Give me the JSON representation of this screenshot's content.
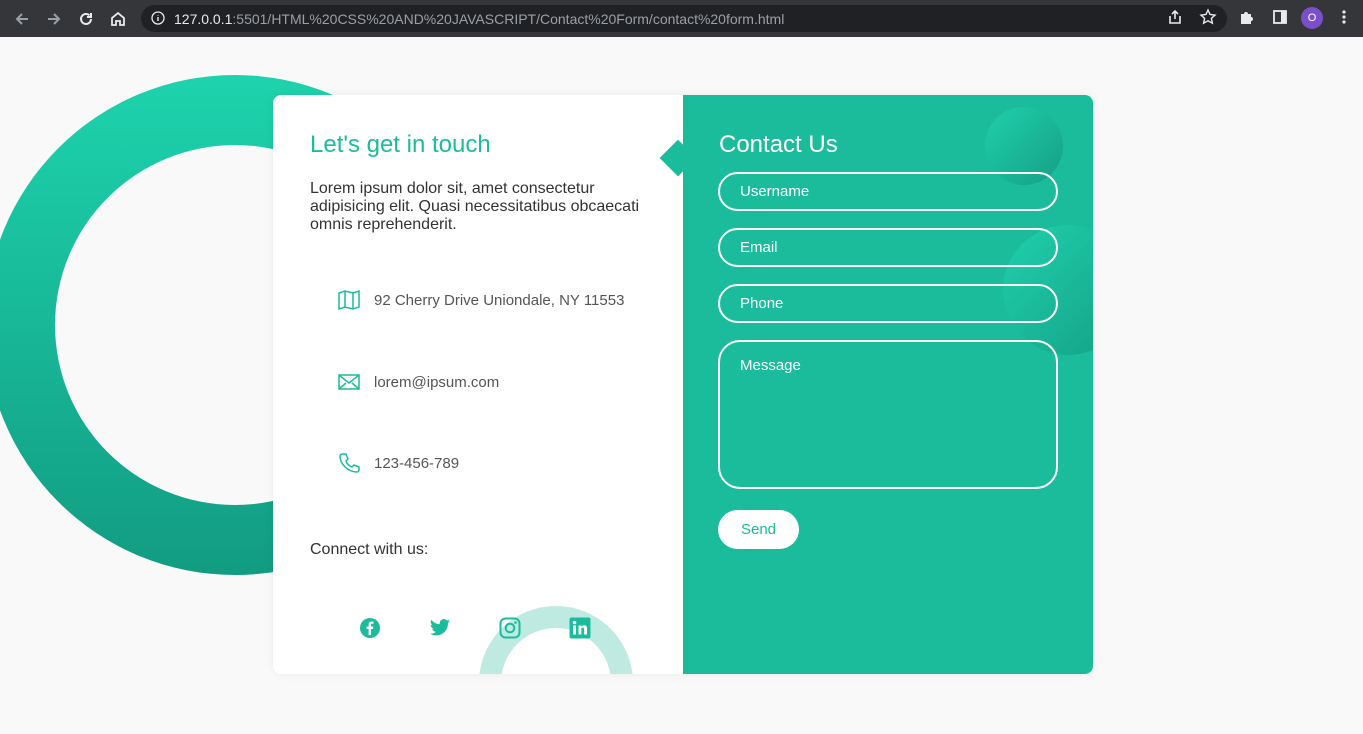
{
  "browser": {
    "url_host": "127.0.0.1",
    "url_rest": ":5501/HTML%20CSS%20AND%20JAVASCRIPT/Contact%20Form/contact%20form.html",
    "profile_initial": "O"
  },
  "contact_info": {
    "title": "Let's get in touch",
    "intro": "Lorem ipsum dolor sit, amet consectetur adipisicing elit. Quasi necessitatibus obcaecati omnis reprehenderit.",
    "address": "92 Cherry Drive Uniondale, NY 11553",
    "email": "lorem@ipsum.com",
    "phone": "123-456-789",
    "connect_label": "Connect with us:",
    "socials": [
      "facebook-icon",
      "twitter-icon",
      "instagram-icon",
      "linkedin-icon"
    ]
  },
  "form": {
    "title": "Contact Us",
    "username_placeholder": "Username",
    "email_placeholder": "Email",
    "phone_placeholder": "Phone",
    "message_placeholder": "Message",
    "send_label": "Send"
  },
  "colors": {
    "accent": "#1abc9c",
    "ring_light": "#bfeae2",
    "chrome_bg": "#35363a"
  }
}
